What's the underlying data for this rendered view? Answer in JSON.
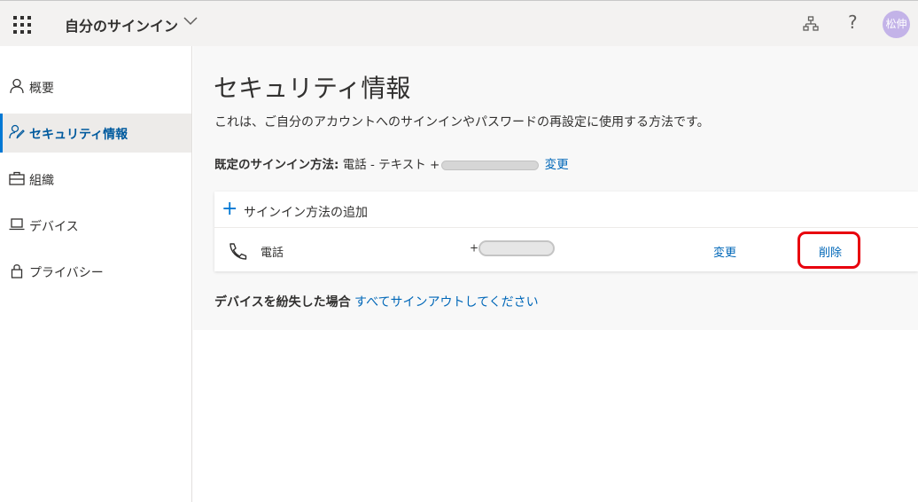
{
  "header": {
    "app_title": "自分のサインイン",
    "avatar_initials": "松伸",
    "help_glyph": "?"
  },
  "sidebar": {
    "items": [
      {
        "label": "概要",
        "icon": "person-icon",
        "active": false
      },
      {
        "label": "セキュリティ情報",
        "icon": "security-info-icon",
        "active": true
      },
      {
        "label": "組織",
        "icon": "briefcase-icon",
        "active": false
      },
      {
        "label": "デバイス",
        "icon": "laptop-icon",
        "active": false
      },
      {
        "label": "プライバシー",
        "icon": "lock-icon",
        "active": false
      }
    ]
  },
  "main": {
    "title": "セキュリティ情報",
    "description": "これは、ご自分のアカウントへのサインインやパスワードの再設定に使用する方法です。",
    "default_method_label": "既定のサインイン方法:",
    "default_method_value": "電話 - テキスト +",
    "default_method_change": "変更",
    "add_method_label": "サインイン方法の追加",
    "methods": [
      {
        "name": "電話",
        "number_prefix": "+",
        "change_label": "変更",
        "delete_label": "削除"
      }
    ],
    "lost_device_label": "デバイスを紛失した場合",
    "sign_out_link": "すべてサインアウトしてください"
  },
  "colors": {
    "accent": "#0078d4",
    "link": "#0067b8",
    "highlight": "#e8000d",
    "avatar": "#c3b3e8"
  }
}
